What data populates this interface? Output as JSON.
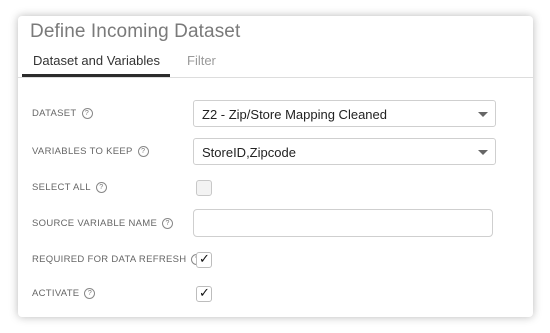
{
  "dialog": {
    "title": "Define Incoming Dataset",
    "tabs": [
      {
        "label": "Dataset and Variables",
        "active": true
      },
      {
        "label": "Filter",
        "active": false
      }
    ]
  },
  "form": {
    "dataset": {
      "label": "DATASET",
      "help": "?",
      "value": "Z2 - Zip/Store Mapping Cleaned"
    },
    "variables": {
      "label": "VARIABLES TO KEEP",
      "help": "?",
      "value": "StoreID,Zipcode"
    },
    "select_all": {
      "label": "SELECT ALL",
      "help": "?",
      "checked": false
    },
    "source_variable": {
      "label": "SOURCE VARIABLE NAME",
      "help": "?",
      "value": ""
    },
    "required_refresh": {
      "label": "REQUIRED FOR DATA REFRESH",
      "help": "?",
      "checked": true,
      "mark": "✓"
    },
    "activate": {
      "label": "ACTIVATE",
      "help": "?",
      "checked": true,
      "mark": "✓"
    }
  }
}
